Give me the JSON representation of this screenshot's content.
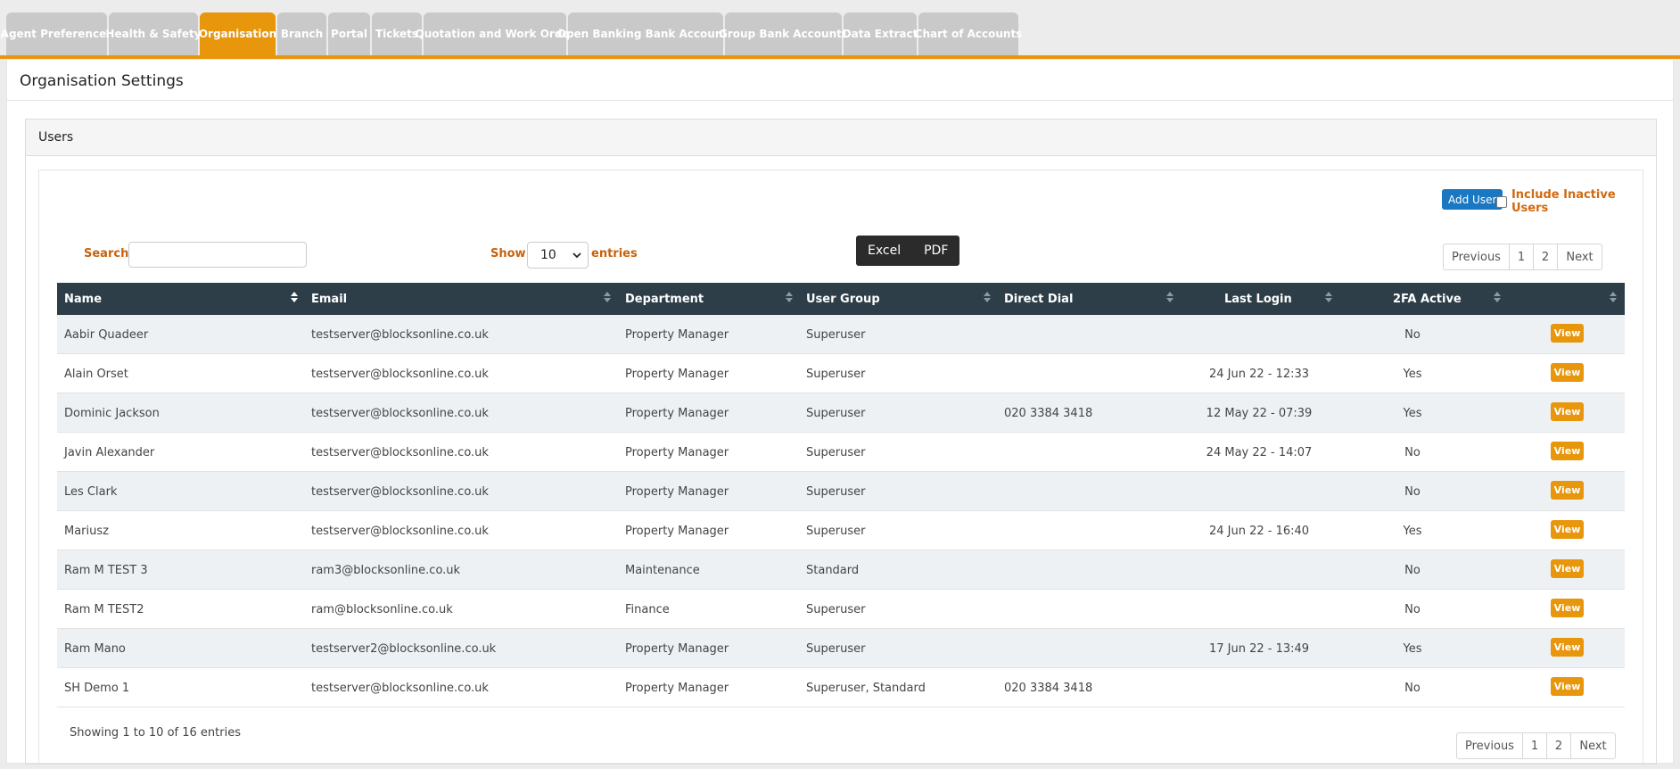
{
  "tabs": [
    {
      "label": "Agent Preferences",
      "active": false
    },
    {
      "label": "Health & Safety",
      "active": false
    },
    {
      "label": "Organisation",
      "active": true
    },
    {
      "label": "Branch",
      "active": false
    },
    {
      "label": "Portal",
      "active": false
    },
    {
      "label": "Tickets",
      "active": false
    },
    {
      "label": "Quotation and Work Order",
      "active": false
    },
    {
      "label": "Open Banking Bank Accounts",
      "active": false
    },
    {
      "label": "Group Bank Accounts",
      "active": false
    },
    {
      "label": "Data Extract",
      "active": false
    },
    {
      "label": "Chart of Accounts",
      "active": false
    }
  ],
  "page_title": "Organisation Settings",
  "users": {
    "title": "Users",
    "add_user": "Add User",
    "include_inactive": "Include Inactive Users",
    "search_label": "Search:",
    "search_value": "",
    "show_label": "Show",
    "show_value": "10",
    "entries_label": "entries",
    "export": {
      "excel": "Excel",
      "pdf": "PDF"
    },
    "pager": {
      "previous": "Previous",
      "pages": [
        "1",
        "2"
      ],
      "next": "Next"
    },
    "columns": [
      "Name",
      "Email",
      "Department",
      "User Group",
      "Direct Dial",
      "Last Login",
      "2FA Active"
    ],
    "view_label": "View",
    "rows": [
      {
        "name": "Aabir Quadeer",
        "email": "testserver@blocksonline.co.uk",
        "department": "Property Manager",
        "group": "Superuser",
        "dial": "",
        "last_login": "",
        "twofa": "No"
      },
      {
        "name": "Alain Orset",
        "email": "testserver@blocksonline.co.uk",
        "department": "Property Manager",
        "group": "Superuser",
        "dial": "",
        "last_login": "24 Jun 22 - 12:33",
        "twofa": "Yes"
      },
      {
        "name": "Dominic Jackson",
        "email": "testserver@blocksonline.co.uk",
        "department": "Property Manager",
        "group": "Superuser",
        "dial": "020 3384 3418",
        "last_login": "12 May 22 - 07:39",
        "twofa": "Yes"
      },
      {
        "name": "Javin Alexander",
        "email": "testserver@blocksonline.co.uk",
        "department": "Property Manager",
        "group": "Superuser",
        "dial": "",
        "last_login": "24 May 22 - 14:07",
        "twofa": "No"
      },
      {
        "name": "Les Clark",
        "email": "testserver@blocksonline.co.uk",
        "department": "Property Manager",
        "group": "Superuser",
        "dial": "",
        "last_login": "",
        "twofa": "No"
      },
      {
        "name": "Mariusz",
        "email": "testserver@blocksonline.co.uk",
        "department": "Property Manager",
        "group": "Superuser",
        "dial": "",
        "last_login": "24 Jun 22 - 16:40",
        "twofa": "Yes"
      },
      {
        "name": "Ram M TEST 3",
        "email": "ram3@blocksonline.co.uk",
        "department": "Maintenance",
        "group": "Standard",
        "dial": "",
        "last_login": "",
        "twofa": "No"
      },
      {
        "name": "Ram M TEST2",
        "email": "ram@blocksonline.co.uk",
        "department": "Finance",
        "group": "Superuser",
        "dial": "",
        "last_login": "",
        "twofa": "No"
      },
      {
        "name": "Ram Mano",
        "email": "testserver2@blocksonline.co.uk",
        "department": "Property Manager",
        "group": "Superuser",
        "dial": "",
        "last_login": "17 Jun 22 - 13:49",
        "twofa": "Yes"
      },
      {
        "name": "SH Demo 1",
        "email": "testserver@blocksonline.co.uk",
        "department": "Property Manager",
        "group": "Superuser, Standard",
        "dial": "020 3384 3418",
        "last_login": "",
        "twofa": "No"
      }
    ],
    "showing": "Showing 1 to 10 of 16 entries"
  },
  "colors": {
    "accent": "#e8960c",
    "header": "#2d3e48",
    "primary": "#1a78c2",
    "label": "#c8620c"
  }
}
